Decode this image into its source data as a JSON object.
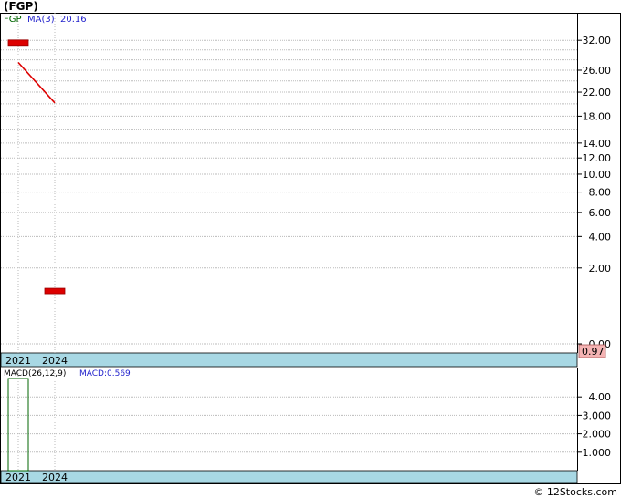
{
  "title": "(FGP)",
  "footer": "© 12Stocks.com",
  "colors": {
    "ticker": "#006600",
    "ma": "#2222cc",
    "price": "#dd0000",
    "axis_bar": "#a8d8e4",
    "last_tag": "#f4b3b3",
    "macd_bar": "#006600",
    "grid": "#bbbbbb"
  },
  "chart_data": [
    {
      "type": "line",
      "panel": "price",
      "legend": {
        "ticker": "FGP",
        "ma_label": "MA(3)",
        "ma_value": "20.16"
      },
      "x_tick_labels": [
        "2021",
        "2024"
      ],
      "y_tick_labels": [
        "32.00",
        "26.00",
        "22.00",
        "18.00",
        "14.00",
        "12.00",
        "10.00",
        "8.00",
        "6.00",
        "4.00",
        "2.00",
        "0.00"
      ],
      "y_ticks": [
        32,
        26,
        22,
        18,
        14,
        12,
        10,
        8,
        6,
        4,
        2,
        0
      ],
      "scale": "sqrt",
      "ylim": [
        0,
        36
      ],
      "extra_gridlines": [
        30,
        28,
        24,
        20,
        16
      ],
      "series": [
        {
          "name": "FGP",
          "kind": "bars",
          "x": [
            "2021",
            "2024"
          ],
          "values": [
            31.5,
            0.97
          ]
        },
        {
          "name": "MA(3)",
          "kind": "line",
          "x": [
            "2021",
            "2024"
          ],
          "values": [
            27.5,
            20.16
          ]
        }
      ],
      "last_value": "0.97"
    },
    {
      "type": "bar",
      "panel": "macd",
      "legend": {
        "label": "MACD(26,12,9)",
        "value_label": "MACD:0.569"
      },
      "x_tick_labels": [
        "2021",
        "2024"
      ],
      "y_tick_labels": [
        "4.00",
        "3.000",
        "2.000",
        "1.000"
      ],
      "y_ticks": [
        4,
        3,
        2,
        1
      ],
      "ylim": [
        0,
        5
      ],
      "series": [
        {
          "name": "MACD",
          "x": [
            "2021"
          ],
          "values": [
            5.0
          ]
        }
      ]
    }
  ]
}
